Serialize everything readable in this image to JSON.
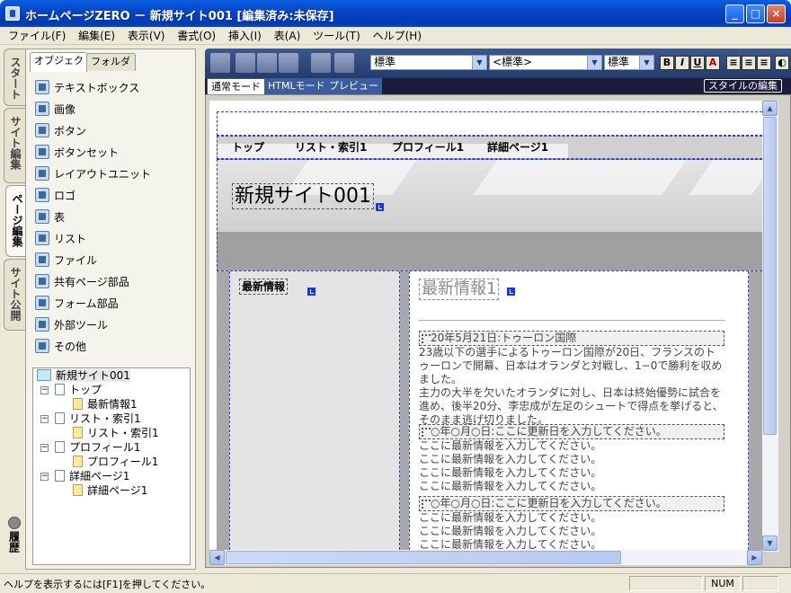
{
  "window": {
    "title": "ホームページZERO － 新規サイト001 [編集済み:未保存]",
    "minimize": "_",
    "maximize": "□",
    "close": "×"
  },
  "menu": [
    "ファイル(F)",
    "編集(E)",
    "表示(V)",
    "書式(O)",
    "挿入(I)",
    "表(A)",
    "ツール(T)",
    "ヘルプ(H)"
  ],
  "side_tabs": [
    "スタート",
    "サイト編集",
    "ページ編集",
    "サイト公開"
  ],
  "history_label": "履歴",
  "panel_tabs": [
    "オブジェクト",
    "フォルダ"
  ],
  "objects": [
    "テキストボックス",
    "画像",
    "ボタン",
    "ボタンセット",
    "レイアウトユニット",
    "ロゴ",
    "表",
    "リスト",
    "ファイル",
    "共有ページ部品",
    "フォーム部品",
    "外部ツール",
    "その他"
  ],
  "tree": {
    "root": "新規サイト001",
    "nodes": [
      {
        "label": "トップ",
        "child": "最新情報1"
      },
      {
        "label": "リスト・索引1",
        "child": "リスト・索引1"
      },
      {
        "label": "プロフィール1",
        "child": "プロフィール1"
      },
      {
        "label": "詳細ページ1",
        "child": "詳細ページ1"
      }
    ]
  },
  "toolbar": {
    "paragraph_style": "標準",
    "char_style": "<標準>",
    "size": "標準",
    "bold": "B",
    "italic": "I",
    "underline": "U",
    "color": "A"
  },
  "mode_tabs": [
    "通常モード",
    "HTMLモード",
    "プレビュー"
  ],
  "style_edit": "スタイルの編集",
  "page": {
    "nav": [
      "トップ",
      "リスト・索引1",
      "プロフィール1",
      "詳細ページ1"
    ],
    "site_title": "新規サイト001",
    "left_heading": "最新情報",
    "right_heading": "最新情報1",
    "entries": [
      {
        "date": "20年5月21日:トゥーロン国際",
        "lines": [
          "23歳以下の選手によるトゥーロン国際が20日、フランスのトゥーロンで開幕、日本はオランダと対戦し、1−0で勝利を収めました。",
          "主力の大半を欠いたオランダに対し、日本は終始優勢に試合を進め、後半20分、李忠成が左足のシュートで得点を挙げると、そのまま逃げ切りました。"
        ]
      },
      {
        "date": "○年○月○日:ここに更新日を入力してください。",
        "lines": [
          "ここに最新情報を入力してください。",
          "ここに最新情報を入力してください。",
          "ここに最新情報を入力してください。",
          "ここに最新情報を入力してください。"
        ]
      },
      {
        "date": "○年○月○日:ここに更新日を入力してください。",
        "lines": [
          "ここに最新情報を入力してください。",
          "ここに最新情報を入力してください。",
          "ここに最新情報を入力してください。"
        ]
      }
    ]
  },
  "status": {
    "message": "ヘルプを表示するには[F1]を押してください。",
    "num": "NUM"
  }
}
